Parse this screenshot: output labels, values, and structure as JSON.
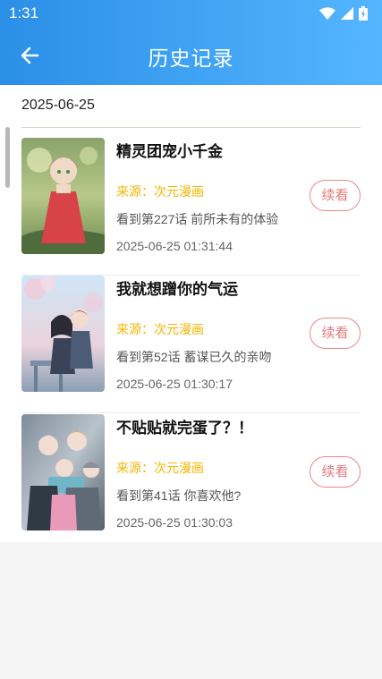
{
  "status_bar": {
    "time": "1:31",
    "icons": [
      "wifi-icon",
      "signal-icon",
      "battery-icon"
    ]
  },
  "header": {
    "title": "历史记录",
    "back_icon": "arrow-left-icon"
  },
  "date_group": "2025-06-25",
  "items": [
    {
      "title": "精灵团宠小千金",
      "source": "来源：次元漫画",
      "progress": "看到第227话 前所未有的体验",
      "time": "2025-06-25 01:31:44",
      "resume_label": "续看"
    },
    {
      "title": "我就想蹭你的气运",
      "source": "来源：次元漫画",
      "progress": "看到第52话 蓄谋已久的亲吻",
      "time": "2025-06-25 01:30:17",
      "resume_label": "续看"
    },
    {
      "title": "不贴贴就完蛋了？！",
      "source": "来源：次元漫画",
      "progress": "看到第41话  你喜欢他?",
      "time": "2025-06-25 01:30:03",
      "resume_label": "续看"
    }
  ],
  "colors": {
    "header_start": "#2a8fe6",
    "header_end": "#55b5ff",
    "source_text": "#f2b600",
    "resume_button": "#e57a7a"
  }
}
